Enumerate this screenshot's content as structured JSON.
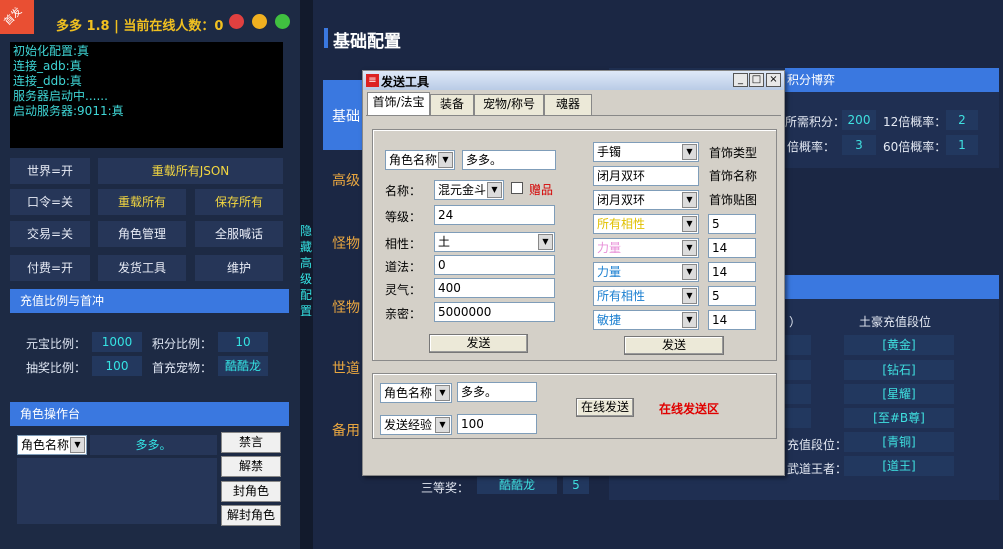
{
  "left": {
    "ribbon": "首发",
    "title": "多多 1.8 | 当前在线人数：",
    "online_count": "0",
    "console": [
      "初始化配置:真",
      "连接_adb:真",
      "连接_ddb:真",
      "服务器启动中......",
      "启动服务器:9011:真"
    ],
    "buttons": {
      "world": "世界=开",
      "reload_json": "重载所有JSON",
      "command": "口令=关",
      "reload_all": "重载所有",
      "save_all": "保存所有",
      "trade": "交易=关",
      "role_manage": "角色管理",
      "broadcast": "全服喊话",
      "pay": "付费=开",
      "send_tool": "发货工具",
      "maintain": "维护"
    },
    "recharge": {
      "header": "充值比例与首冲",
      "yuanbao_label": "元宝比例：",
      "yuanbao_value": "1000",
      "points_label": "积分比例：",
      "points_value": "10",
      "lottery_label": "抽奖比例：",
      "lottery_value": "100",
      "pet_label": "首充宠物：",
      "pet_value": "酷酷龙"
    },
    "role": {
      "header": "角色操作台",
      "select": "角色名称",
      "name": "多多。",
      "mute": "禁言",
      "unmute": "解禁",
      "ban": "封角色",
      "unban": "解封角色"
    },
    "vertical_text": [
      "隐",
      "藏",
      "高",
      "级",
      "配",
      "置"
    ]
  },
  "right": {
    "title": "基础配置",
    "side_items": [
      "基础",
      "高级",
      "怪物",
      "怪物",
      "世道",
      "备用"
    ],
    "section1_header": "积分博弈",
    "need_points_label": "所需积分：",
    "need_points_value": "200",
    "p12_label": "12倍概率：",
    "p12_value": "2",
    "px_label": "倍概率：",
    "px_value": "3",
    "p60_label": "60倍概率：",
    "p60_value": "1",
    "section2_paren": "）",
    "tycoon_header": "土豪充值段位",
    "tiers": [
      "[黄金]",
      "[钻石]",
      "[星耀]",
      "[至#B尊]",
      "[青铜]",
      "[道王]"
    ],
    "tier_label1": "充值段位：",
    "tier_label2": "武道王者：",
    "third_prize_label": "三等奖：",
    "third_prize_pet": "酷酷龙",
    "third_prize_value": "5"
  },
  "dialog": {
    "title": "发送工具",
    "tabs": [
      "首饰/法宝",
      "装备",
      "宠物/称号",
      "魂器"
    ],
    "role_select": "角色名称",
    "role_name": "多多。",
    "name_label": "名称：",
    "name_value": "混元金斗",
    "gift_label": "赠品",
    "level_label": "等级：",
    "level_value": "24",
    "phase_label": "相性：",
    "phase_value": "土",
    "dao_label": "道法：",
    "dao_value": "0",
    "lingqi_label": "灵气：",
    "lingqi_value": "400",
    "qinmi_label": "亲密：",
    "qinmi_value": "5000000",
    "send_left": "发送",
    "acc_type_value": "手镯",
    "acc_type_label": "首饰类型",
    "acc_name_value": "闭月双环",
    "acc_name_label": "首饰名称",
    "acc_img_value": "闭月双环",
    "acc_img_label": "首饰贴图",
    "attrs": [
      {
        "name": "所有相性",
        "value": "5",
        "color": "#e0c000"
      },
      {
        "name": "力量",
        "value": "14",
        "color": "#e890d8"
      },
      {
        "name": "力量",
        "value": "14",
        "color": "#1a7fd0"
      },
      {
        "name": "所有相性",
        "value": "5",
        "color": "#1a7fd0"
      },
      {
        "name": "敏捷",
        "value": "14",
        "color": "#1a7fd0"
      }
    ],
    "send_right": "发送",
    "bottom_role_select": "角色名称",
    "bottom_role_name": "多多。",
    "exp_select": "发送经验",
    "exp_value": "100",
    "online_send": "在线发送",
    "online_area": "在线发送区"
  }
}
